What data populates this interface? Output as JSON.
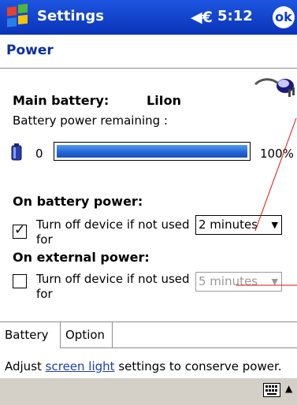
{
  "titlebar": {
    "app_title": "Settings",
    "volume_icon": "speaker-icon",
    "clock": "5:12",
    "ok_label": "ok",
    "colors": {
      "bar": "#0b3cc8",
      "text": "#ffffff"
    }
  },
  "page": {
    "heading": "Power"
  },
  "battery": {
    "main_label": "Main battery:",
    "type": "LiIon",
    "remaining_label": "Battery power remaining :",
    "min_label": "0",
    "max_label": "100%",
    "level_fraction": 1.0
  },
  "on_battery": {
    "heading": "On battery power:",
    "option_label": "Turn off device if not used for",
    "checked": true,
    "timeout": "2 minutes"
  },
  "on_external": {
    "heading": "On external power:",
    "option_label": "Turn off device if not used for",
    "checked": false,
    "timeout": "5 minutes"
  },
  "tabs": [
    {
      "label": "Battery",
      "active": true
    },
    {
      "label": "Option",
      "active": false
    }
  ],
  "hint": {
    "before": "Adjust ",
    "link": "screen light",
    "after": " settings to conserve power."
  },
  "annotation_color": "#e01010"
}
